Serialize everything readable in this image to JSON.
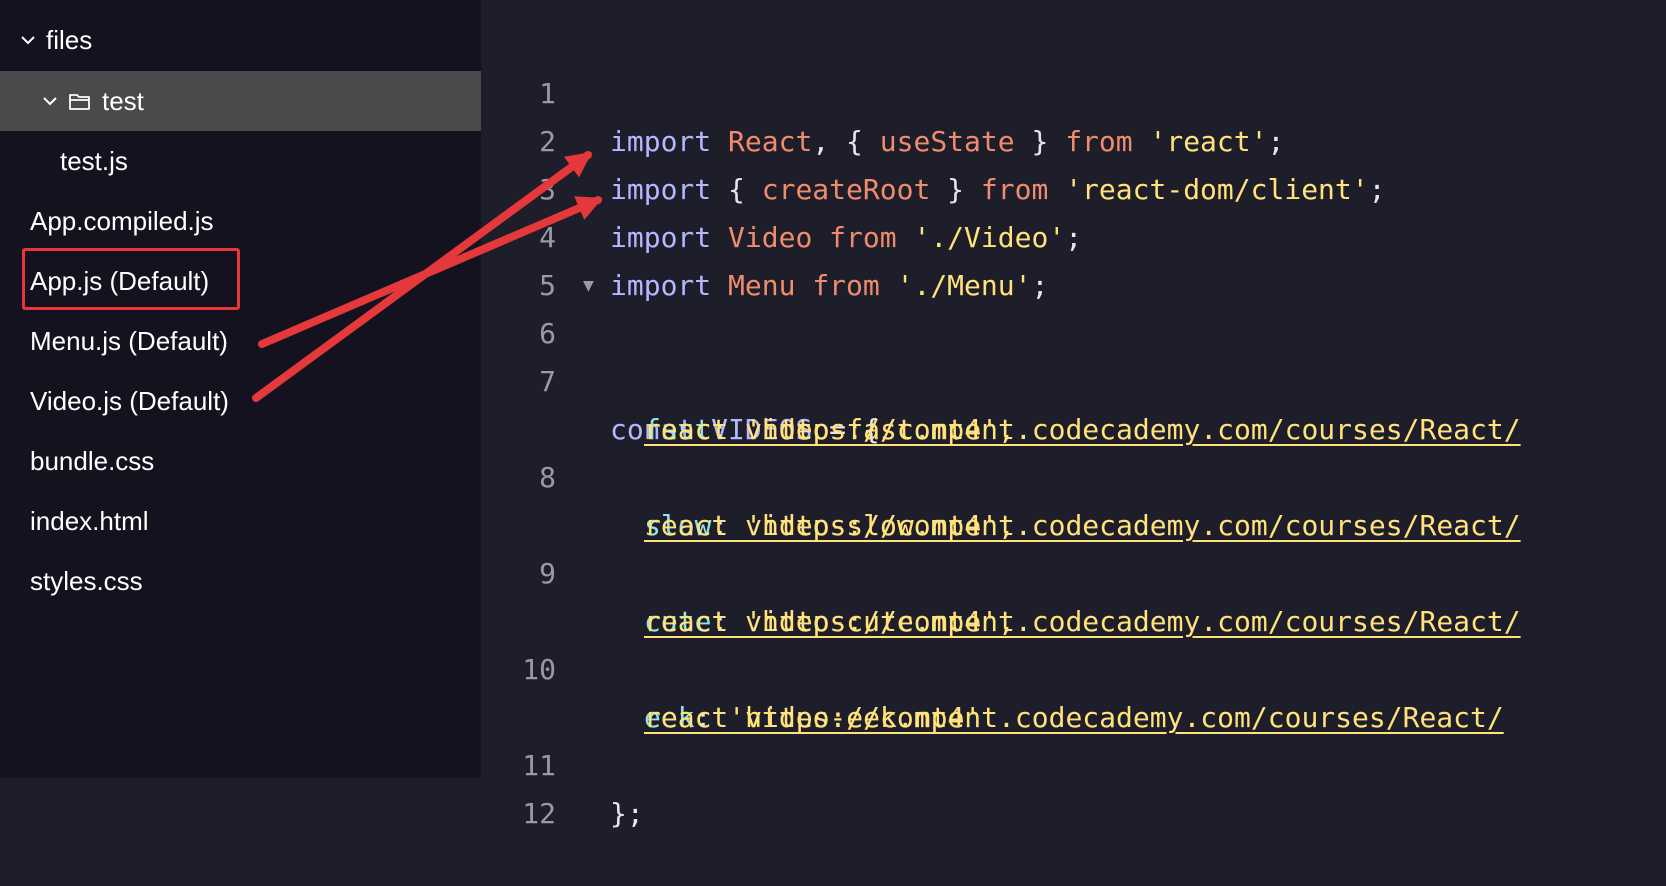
{
  "explorer": {
    "root_label": "files",
    "folder_label": "test",
    "items": [
      {
        "label": "test.js"
      },
      {
        "label": "App.compiled.js"
      },
      {
        "label": "App.js (Default)"
      },
      {
        "label": "Menu.js (Default)"
      },
      {
        "label": "Video.js (Default)"
      },
      {
        "label": "bundle.css"
      },
      {
        "label": "index.html"
      },
      {
        "label": "styles.css"
      }
    ]
  },
  "editor": {
    "line_numbers": [
      "1",
      "2",
      "3",
      "4",
      "5",
      "6",
      "7",
      "",
      "8",
      "",
      "9",
      "",
      "10",
      "",
      "11",
      "12"
    ],
    "code": {
      "l1": {
        "kw": "import",
        "id1": "React",
        "p1": ", { ",
        "id2": "useState",
        "p2": " } ",
        "kw2": "from",
        "str": "'react'",
        "end": ";"
      },
      "l2": {
        "kw": "import",
        "p1": " { ",
        "id": "createRoot",
        "p2": " } ",
        "kw2": "from",
        "str": "'react-dom/client'",
        "end": ";"
      },
      "l3": {
        "kw": "import",
        "id": "Video",
        "kw2": "from",
        "str": "'./Video'",
        "end": ";"
      },
      "l4": {
        "kw": "import",
        "id": "Menu",
        "kw2": "from",
        "str": "'./Menu'",
        "end": ";"
      },
      "l6": {
        "kw": "const",
        "name": "VIDEOS",
        "rest": " = {"
      },
      "videos": [
        {
          "key": "fast",
          "url_a": "https://content.codecademy.com/courses/React/",
          "url_b": "react_video-fast.mp4",
          "end": "',"
        },
        {
          "key": "slow",
          "url_a": "https://content.codecademy.com/courses/React/",
          "url_b": "react_video-slow.mp4",
          "end": "',"
        },
        {
          "key": "cute",
          "url_a": "https://content.codecademy.com/courses/React/",
          "url_b": "react_video-cute.mp4",
          "end": "',"
        },
        {
          "key": "eek",
          "url_a": "https://content.codecademy.com/courses/React/",
          "url_b": "react_video-eek.mp4",
          "end": "'"
        }
      ],
      "l11": "};"
    }
  },
  "colors": {
    "sidebar_bg": "#14121f",
    "editor_bg": "#1e1d2a",
    "active_row": "#4a4a4c",
    "keyword": "#b4b8ff",
    "identifier": "#f08c6e",
    "string": "#ffe27a",
    "property": "#8fe3e8",
    "annotation_red": "#e5383b"
  }
}
